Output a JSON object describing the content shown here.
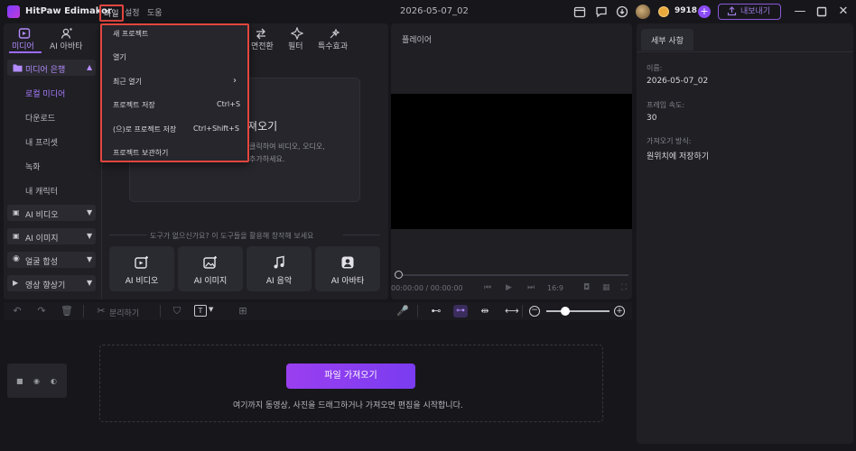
{
  "app": {
    "name": "HitPaw Edimakor",
    "doc_title": "2026-05-07_02",
    "credits": "9918",
    "export_label": "내보내기"
  },
  "top_menu": [
    "파일",
    "설정",
    "도움"
  ],
  "media_tabs": [
    {
      "label": "미디어",
      "icon": "media-icon",
      "active": true
    },
    {
      "label": "AI 아바타",
      "icon": "avatar-icon"
    },
    {
      "label": "면전환",
      "icon": "transition-icon"
    },
    {
      "label": "필터",
      "icon": "filter-icon"
    },
    {
      "label": "특수효과",
      "icon": "effects-icon"
    }
  ],
  "sidebar": {
    "library": "미디어 은행",
    "library_items": [
      "로컬 미디어",
      "다운로드",
      "내 프리셋",
      "녹화",
      "내 캐릭터"
    ],
    "groups": [
      "AI 비디오",
      "AI  이미지",
      "얼굴 합성",
      "영상 향상기"
    ]
  },
  "import_box": {
    "title": "가져오기",
    "desc_line1": "클릭하여 비디오, 오디오,",
    "desc_line2": "추가하세요."
  },
  "tools": {
    "hint": "도구가 없으신가요? 이 도구들을 활용해 창작해 보세요",
    "items": [
      {
        "label": "AI 비디오",
        "icon": "ai-video-icon"
      },
      {
        "label": "AI  이미지",
        "icon": "ai-image-icon"
      },
      {
        "label": "AI 음악",
        "icon": "ai-music-icon"
      },
      {
        "label": "AI 아바타",
        "icon": "ai-avatar-icon"
      }
    ]
  },
  "player": {
    "title": "플레이어",
    "time": "00:00:00 / 00:00:00",
    "ratio": "16:9"
  },
  "details": {
    "tab": "세부 사항",
    "fields": [
      {
        "label": "이름:",
        "value": "2026-05-07_02"
      },
      {
        "label": "프레임 속도:",
        "value": "30"
      },
      {
        "label": "가져오기 방식:",
        "value": "원위치에 저장하기"
      }
    ]
  },
  "toolbar": {
    "split_label": "분리하기"
  },
  "timeline": {
    "import_button": "파일 가져오기",
    "hint": "여기까지 동영상, 사진을 드래그하거나 가져오면 편집을 시작합니다."
  },
  "file_menu": {
    "items": [
      {
        "label": "새 프로젝트",
        "shortcut": ""
      },
      {
        "label": "열기",
        "shortcut": ""
      },
      {
        "label": "최근 열기",
        "shortcut": ""
      },
      {
        "label": "프로젝트 저장",
        "shortcut": "Ctrl+S"
      },
      {
        "label": "(으)로 프로젝트 저장",
        "shortcut": "Ctrl+Shift+S"
      },
      {
        "label": "프로젝트 보관하기",
        "shortcut": ""
      }
    ]
  },
  "colors": {
    "accent": "#9a6bff",
    "highlight": "#e2463f",
    "button": "#8f3ff0"
  }
}
